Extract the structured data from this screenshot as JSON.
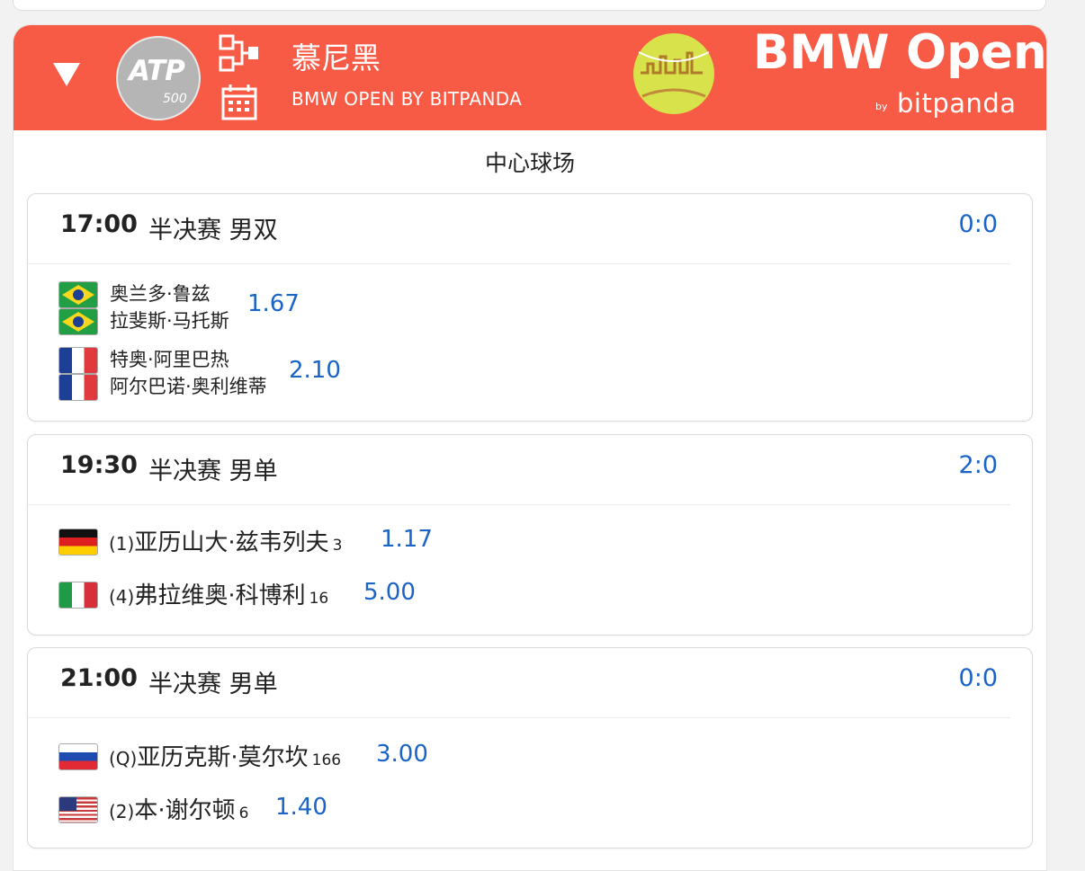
{
  "header": {
    "city": "慕尼黑",
    "tournament": "BMW OPEN BY BITPANDA",
    "atp_logo_text": "ATP",
    "atp_level": "500",
    "brand_title": "BMW Open",
    "brand_by": "by",
    "brand_sponsor": "bitpanda",
    "color": "#f75b45"
  },
  "court": "中心球场",
  "matches": [
    {
      "time": "17:00",
      "round": "半决赛 男双",
      "score": "0:0",
      "team1": {
        "players": [
          "奥兰多·鲁兹",
          "拉斐斯·马托斯"
        ],
        "flag": "brazil-flag-icon",
        "odds": "1.67"
      },
      "team2": {
        "players": [
          "特奥·阿里巴热",
          "阿尔巴诺·奥利维蒂"
        ],
        "flag": "france-flag-icon",
        "odds": "2.10"
      }
    },
    {
      "time": "19:30",
      "round": "半决赛 男单",
      "score": "2:0",
      "p1": {
        "seed": "(1)",
        "name": "亚历山大·兹韦列夫",
        "rank": "3",
        "odds": "1.17",
        "flag": "germany-flag-icon"
      },
      "p2": {
        "seed": "(4)",
        "name": "弗拉维奥·科博利",
        "rank": "16",
        "odds": "5.00",
        "flag": "italy-flag-icon"
      }
    },
    {
      "time": "21:00",
      "round": "半决赛 男单",
      "score": "0:0",
      "p1": {
        "seed": "(Q)",
        "name": "亚历克斯·莫尔坎",
        "rank": "166",
        "odds": "3.00",
        "flag": "slovakia-flag-icon"
      },
      "p2": {
        "seed": "(2)",
        "name": "本·谢尔顿",
        "rank": "6",
        "odds": "1.40",
        "flag": "usa-flag-icon"
      }
    }
  ],
  "colors": {
    "accent": "#f75b45",
    "odds": "#1a63c7"
  }
}
